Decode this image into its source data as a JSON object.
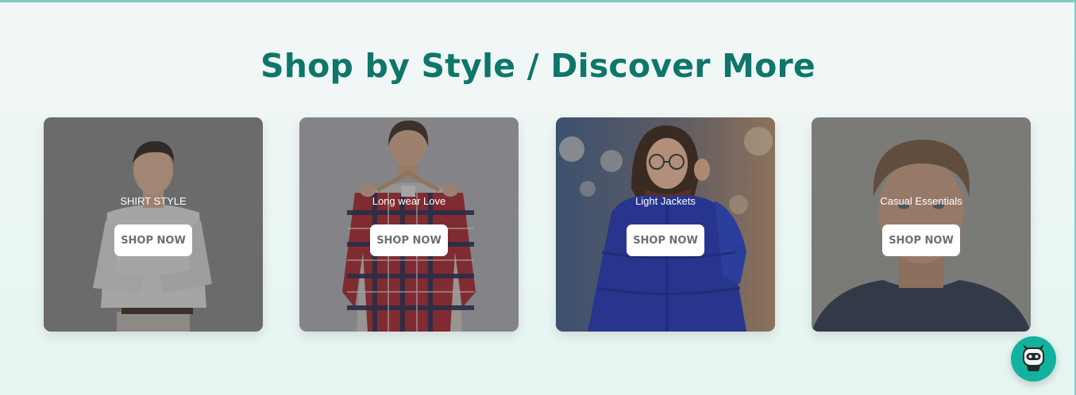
{
  "section": {
    "title": "Shop by Style / Discover More"
  },
  "cards": [
    {
      "label": "SHIRT STYLE",
      "button": "SHOP NOW"
    },
    {
      "label": "Long wear Love",
      "button": "SHOP NOW"
    },
    {
      "label": "Light Jackets",
      "button": "SHOP NOW"
    },
    {
      "label": "Casual Essentials",
      "button": "SHOP NOW"
    }
  ],
  "chat_widget": {
    "icon": "robot-icon"
  },
  "colors": {
    "title": "#0e766a",
    "accent": "#13b29f",
    "border": "#7ecfc3"
  }
}
